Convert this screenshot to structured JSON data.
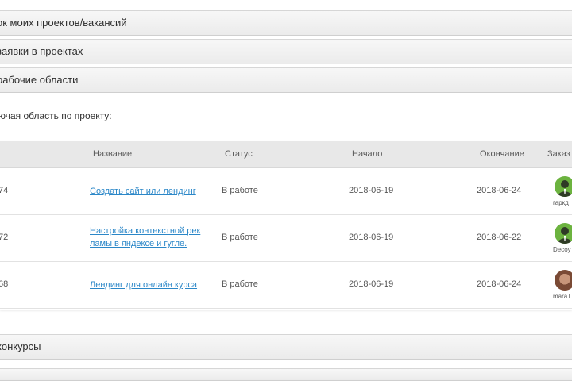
{
  "sections": {
    "projects_label": "ок моих проектов/вакансий",
    "requests_label": "заявки в проектах",
    "workspaces_label": "рабочие области",
    "contests_label": "конкурсы"
  },
  "workspace": {
    "title": "ючая область по проекту:"
  },
  "table": {
    "headers": {
      "name": "Название",
      "status": "Статус",
      "start": "Начало",
      "end": "Окончание",
      "customer": "Заказ"
    },
    "rows": [
      {
        "id": "74",
        "name": "Создать сайт или лендинг",
        "status": "В работе",
        "start": "2018-06-19",
        "end": "2018-06-24",
        "customer": "гаркд"
      },
      {
        "id": "72",
        "name": "Настройка контекстной рек ламы в яндексе и гугле.",
        "status": "В работе",
        "start": "2018-06-19",
        "end": "2018-06-22",
        "customer": "Decoy"
      },
      {
        "id": "68",
        "name": "Лендинг для онлайн курса",
        "status": "В работе",
        "start": "2018-06-19",
        "end": "2018-06-24",
        "customer": "maraT"
      }
    ]
  },
  "colors": {
    "link": "#2b87c8",
    "avatar_green": "#6cb33f",
    "header_bg": "#e8e8e8"
  },
  "icons": {
    "avatar_default": "user-silhouette-icon"
  }
}
